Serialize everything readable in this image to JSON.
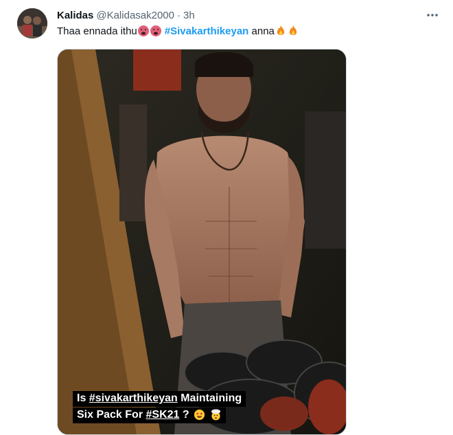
{
  "tweet": {
    "display_name": "Kalidas",
    "handle": "@Kalidasak2000",
    "separator": "·",
    "time": "3h",
    "more_icon": "more-dots-icon",
    "text_before": "Thaa ennada ithu",
    "hashtag": "#Sivakarthikeyan",
    "text_after": " anna",
    "hashtag_color": "#1d9bf0",
    "emojis": [
      "nauseated-face-icon",
      "nauseated-face-icon",
      "fire-icon",
      "fire-icon"
    ]
  },
  "media": {
    "caption_line1_prefix": "Is ",
    "caption_line1_tag": "#sivakarthikeyan",
    "caption_line1_suffix": " Maintaining",
    "caption_line2_prefix": "Six Pack For ",
    "caption_line2_tag": "#SK21",
    "caption_line2_suffix": " ?",
    "caption_emojis": [
      "star-struck-icon",
      "exploding-head-icon"
    ]
  }
}
